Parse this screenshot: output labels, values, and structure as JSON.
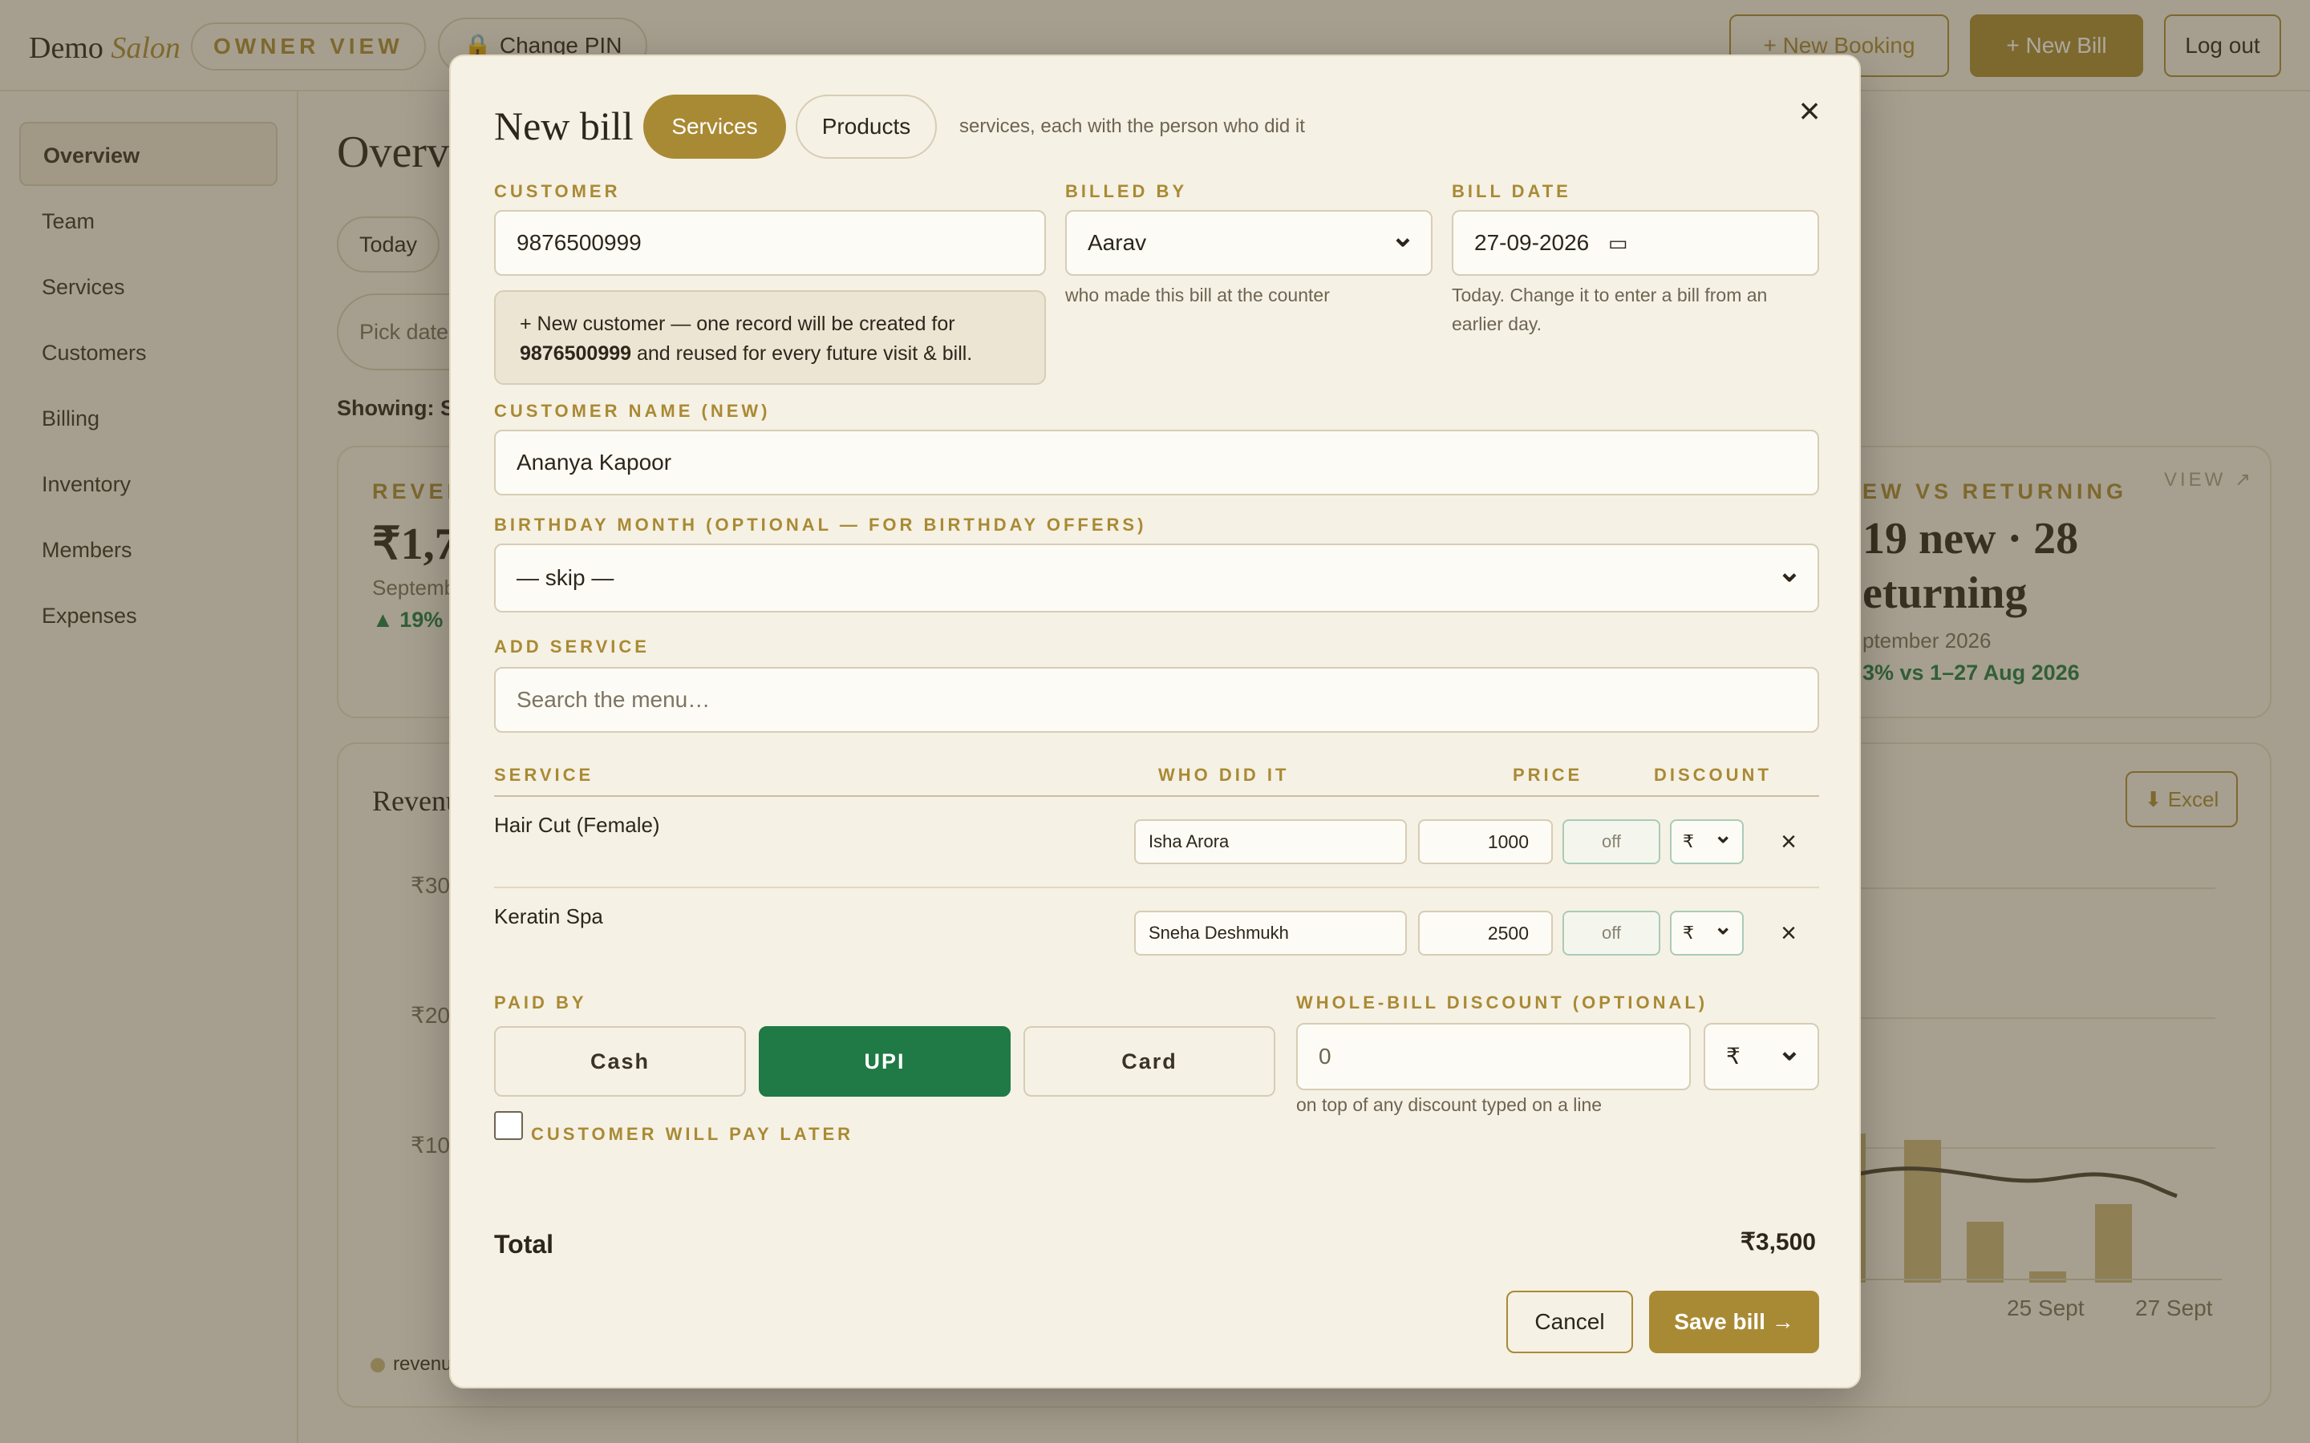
{
  "app": {
    "brand_main": "Demo",
    "brand_accent": "Salon",
    "owner_view": "OWNER VIEW",
    "change_pin": "Change PIN",
    "new_booking": "+ New Booking",
    "new_bill": "+ New Bill",
    "logout": "Log out"
  },
  "sidebar": {
    "items": [
      {
        "label": "Overview",
        "active": true
      },
      {
        "label": "Team"
      },
      {
        "label": "Services"
      },
      {
        "label": "Customers"
      },
      {
        "label": "Billing"
      },
      {
        "label": "Inventory"
      },
      {
        "label": "Members"
      },
      {
        "label": "Expenses"
      }
    ]
  },
  "overview": {
    "title": "Overview",
    "chip_today": "Today",
    "pick_dates": "Pick dates",
    "showing": "Showing: Se",
    "revenue_label": "REVEN",
    "revenue_value": "₹1,7",
    "revenue_sub": "Septembe",
    "revenue_change": "▲ 19% v",
    "nvr_label": "EW VS RETURNING",
    "nvr_value_1": "19 new · 28",
    "nvr_value_2": "eturning",
    "nvr_sub": "ptember 2026",
    "nvr_change": "3% vs 1–27 Aug 2026",
    "view": "VIEW ↗",
    "chart_title": "Revenu",
    "excel": "⬇ Excel",
    "y_ticks": [
      "₹30",
      "₹20",
      "₹10"
    ],
    "x_ticks": [
      "25 Sept",
      "27 Sept"
    ],
    "legend": "revenu"
  },
  "modal": {
    "title": "New bill",
    "tab_services": "Services",
    "tab_products": "Products",
    "tab_hint": "services, each with the person who did it",
    "customer_label": "CUSTOMER",
    "customer_value": "9876500999",
    "billed_by_label": "BILLED BY",
    "billed_by_value": "Aarav",
    "billed_by_hint": "who made this bill at the counter",
    "bill_date_label": "BILL DATE",
    "bill_date_value": "27-09-2026",
    "bill_date_hint": "Today. Change it to enter a bill from an earlier day.",
    "notice_pre": "+  New customer — one record will be created for",
    "notice_number": "9876500999",
    "notice_post": "and reused for every future visit & bill.",
    "customer_name_label": "CUSTOMER NAME (NEW)",
    "customer_name_value": "Ananya Kapoor",
    "birthday_label": "BIRTHDAY MONTH (OPTIONAL — FOR BIRTHDAY OFFERS)",
    "birthday_value": "— skip —",
    "add_service_label": "ADD SERVICE",
    "add_service_placeholder": "Search the menu…",
    "columns": {
      "service": "SERVICE",
      "who": "WHO DID IT",
      "price": "PRICE",
      "discount": "DISCOUNT"
    },
    "lines": [
      {
        "service": "Hair Cut (Female)",
        "staff": "Isha Arora",
        "price": "1000",
        "discount": "off",
        "unit": "₹"
      },
      {
        "service": "Keratin Spa",
        "staff": "Sneha Deshmukh",
        "price": "2500",
        "discount": "off",
        "unit": "₹"
      }
    ],
    "paid_by_label": "PAID BY",
    "pay_options": [
      "Cash",
      "UPI",
      "Card"
    ],
    "pay_selected": "UPI",
    "pay_later_label": "CUSTOMER WILL PAY LATER",
    "whole_discount_label": "WHOLE-BILL DISCOUNT (OPTIONAL)",
    "whole_discount_value": "0",
    "whole_discount_unit": "₹",
    "whole_discount_hint": "on top of any discount typed on a line",
    "total_label": "Total",
    "total_value": "₹3,500",
    "cancel": "Cancel",
    "save": "Save bill →"
  },
  "colors": {
    "accent": "#a98a34",
    "selected_payment": "#1f7a45",
    "background": "#f4efe3"
  }
}
